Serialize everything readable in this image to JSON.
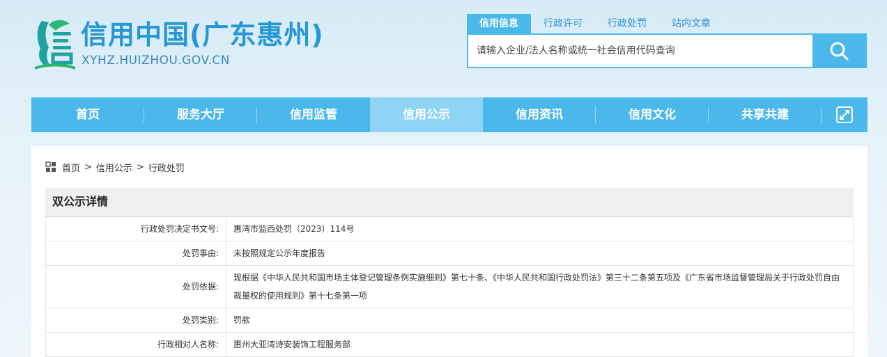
{
  "header": {
    "title": "信用中国(广东惠州)",
    "url": "XYHZ.HUIZHOU.GOV.CN",
    "logo_icon": "credit-china-logo-icon"
  },
  "search": {
    "tabs": [
      {
        "label": "信用信息",
        "active": true
      },
      {
        "label": "行政许可",
        "active": false
      },
      {
        "label": "行政处罚",
        "active": false
      },
      {
        "label": "站内文章",
        "active": false
      }
    ],
    "placeholder": "请输入企业/法人名称或统一社会信用代码查询",
    "button_icon": "search-icon"
  },
  "nav": {
    "items": [
      {
        "label": "首页",
        "active": false
      },
      {
        "label": "服务大厅",
        "active": false
      },
      {
        "label": "信用监管",
        "active": false
      },
      {
        "label": "信用公示",
        "active": true
      },
      {
        "label": "信用资讯",
        "active": false
      },
      {
        "label": "信用文化",
        "active": false
      },
      {
        "label": "共享共建",
        "active": false
      }
    ],
    "expand_icon": "expand-icon"
  },
  "breadcrumb": {
    "icon": "grid-icon",
    "items": [
      "首页",
      "信用公示",
      "行政处罚"
    ],
    "separator": ">"
  },
  "detail": {
    "title": "双公示详情",
    "rows": [
      {
        "label": "行政处罚决定书文号:",
        "value": "惠湾市监西处罚（2023）114号"
      },
      {
        "label": "处罚事由:",
        "value": "未按照规定公示年度报告"
      },
      {
        "label": "处罚依据:",
        "value": "现根据《中华人民共和国市场主体登记管理条例实施细则》第七十条、《中华人民共和国行政处罚法》第三十二条第五项及《广东省市场监督管理局关于行政处罚自由裁量权的使用规则》第十七条第一项"
      },
      {
        "label": "处罚类别:",
        "value": "罚款"
      },
      {
        "label": "行政相对人名称:",
        "value": "惠州大亚湾诗安装饰工程服务部"
      }
    ]
  },
  "colors": {
    "primary": "#4bb8ec",
    "nav_active": "#8fd3f5",
    "title_blue": "#2596d6"
  }
}
